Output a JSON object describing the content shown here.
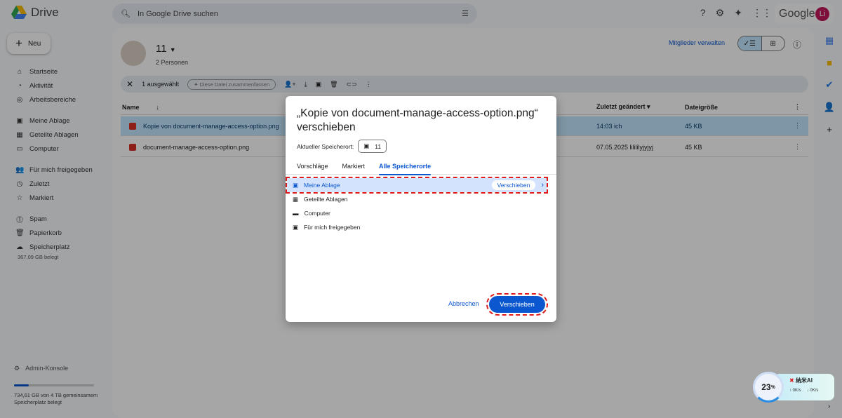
{
  "app": {
    "name": "Drive",
    "google": "Google",
    "avatar": "Li"
  },
  "search": {
    "placeholder": "In Google Drive suchen"
  },
  "sidebar": {
    "new": "Neu",
    "items": [
      {
        "icon": "home-icon",
        "glyph": "⌂",
        "label": "Startseite"
      },
      {
        "icon": "activity-icon",
        "glyph": "◔",
        "label": "Aktivität"
      },
      {
        "icon": "workspaces-icon",
        "glyph": "◎",
        "label": "Arbeitsbereiche"
      },
      {
        "icon": "my-drive-icon",
        "glyph": "▣",
        "label": "Meine Ablage"
      },
      {
        "icon": "shared-drives-icon",
        "glyph": "▦",
        "label": "Geteilte Ablagen"
      },
      {
        "icon": "computer-icon",
        "glyph": "▭",
        "label": "Computer"
      },
      {
        "icon": "shared-with-me-icon",
        "glyph": "👥",
        "label": "Für mich freigegeben"
      },
      {
        "icon": "recent-icon",
        "glyph": "◷",
        "label": "Zuletzt"
      },
      {
        "icon": "star-icon",
        "glyph": "☆",
        "label": "Markiert"
      },
      {
        "icon": "spam-icon",
        "glyph": "⓵",
        "label": "Spam"
      },
      {
        "icon": "trash-icon",
        "glyph": "🗑",
        "label": "Papierkorb"
      },
      {
        "icon": "cloud-icon",
        "glyph": "☁",
        "label": "Speicherplatz"
      }
    ],
    "storage_used": "367,09 GB belegt",
    "admin": "Admin-Konsole",
    "storage_total": "734,61 GB von 4 TB gemeinsamem Speicherplatz belegt",
    "storage_fraction": 0.18
  },
  "folder": {
    "title": "11",
    "people": "2 Personen",
    "members": "Mitglieder verwalten"
  },
  "selection": {
    "count": "1 ausgewählt",
    "summarize": "Diese Datei zusammenfassen"
  },
  "table": {
    "headers": [
      "Name",
      "Zuletzt geändert",
      "Dateigröße"
    ],
    "rows": [
      {
        "name": "Kopie von document-manage-access-option.png",
        "modified": "14:03 ich",
        "size": "45 KB"
      },
      {
        "name": "document-manage-access-option.png",
        "modified": "07.05.2025 lilililyjyjyj",
        "size": "45 KB"
      }
    ]
  },
  "dialog": {
    "title": "„Kopie von document-manage-access-option.png“ verschieben",
    "current_label": "Aktueller Speicherort:",
    "current_value": "11",
    "tabs": [
      "Vorschläge",
      "Markiert",
      "Alle Speicherorte"
    ],
    "locations": [
      "Meine Ablage",
      "Geteilte Ablagen",
      "Computer",
      "Für mich freigegeben"
    ],
    "row_move": "Verschieben",
    "cancel": "Abbrechen",
    "move": "Verschieben"
  },
  "widget": {
    "percent": "23",
    "unit": "%",
    "name": "纳米AI",
    "up": "0K/s",
    "down": "0K/s"
  }
}
